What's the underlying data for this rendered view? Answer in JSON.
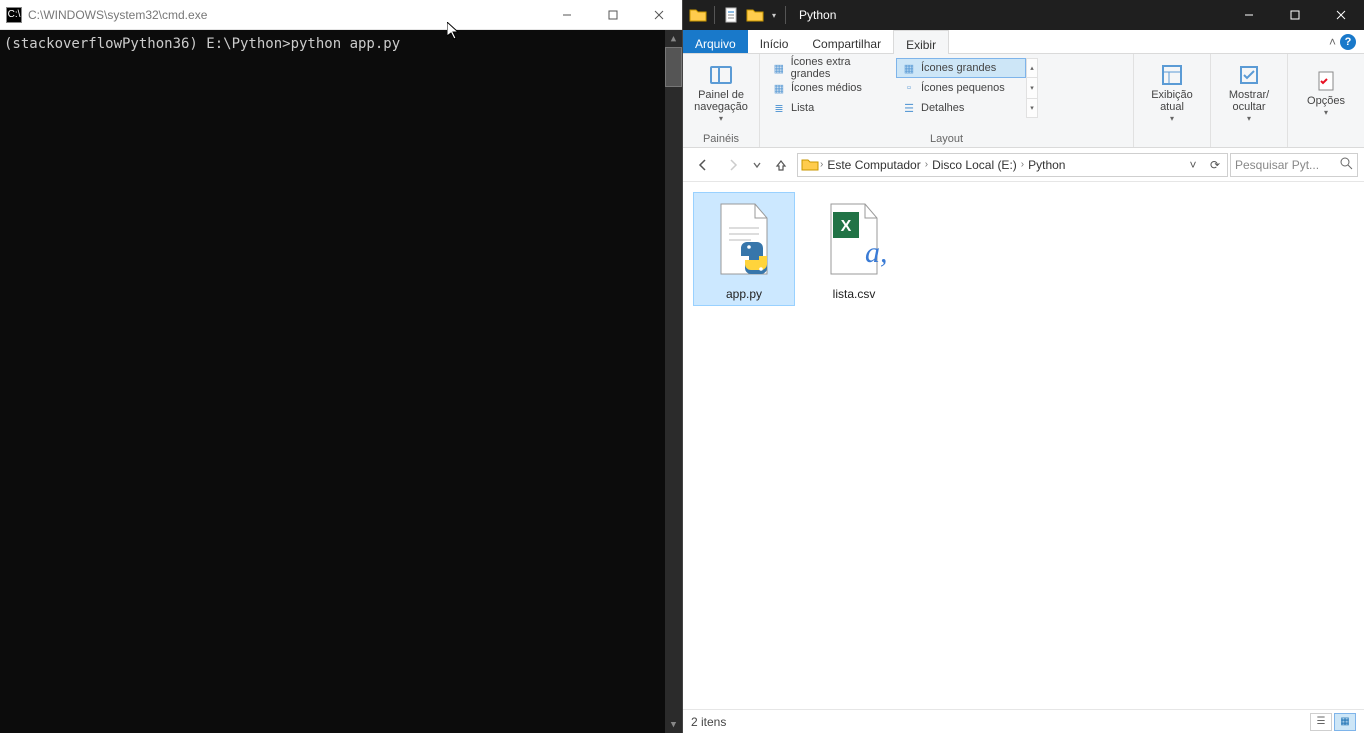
{
  "cmd": {
    "title": "C:\\WINDOWS\\system32\\cmd.exe",
    "icon_label": "C:\\",
    "prompt": "(stackoverflowPython36) E:\\Python>python app.py"
  },
  "explorer": {
    "title": "Python",
    "tabs": {
      "file": "Arquivo",
      "home": "Início",
      "share": "Compartilhar",
      "view": "Exibir"
    },
    "ribbon": {
      "panes_group_label": "Painéis",
      "layout_group_label": "Layout",
      "nav_pane": "Painel de navegação",
      "view_items": [
        "Ícones extra grandes",
        "Ícones grandes",
        "Ícones médios",
        "Ícones pequenos",
        "Lista",
        "Detalhes"
      ],
      "selected_view": "Ícones grandes",
      "current_view": "Exibição atual",
      "show_hide": "Mostrar/ ocultar",
      "options": "Opções"
    },
    "breadcrumb": [
      "Este Computador",
      "Disco Local (E:)",
      "Python"
    ],
    "refresh_tip": "⟳",
    "search_placeholder": "Pesquisar Pyt...",
    "files": [
      {
        "name": "app.py",
        "selected": true,
        "kind": "python"
      },
      {
        "name": "lista.csv",
        "selected": false,
        "kind": "csv"
      }
    ],
    "status": "2 itens"
  }
}
